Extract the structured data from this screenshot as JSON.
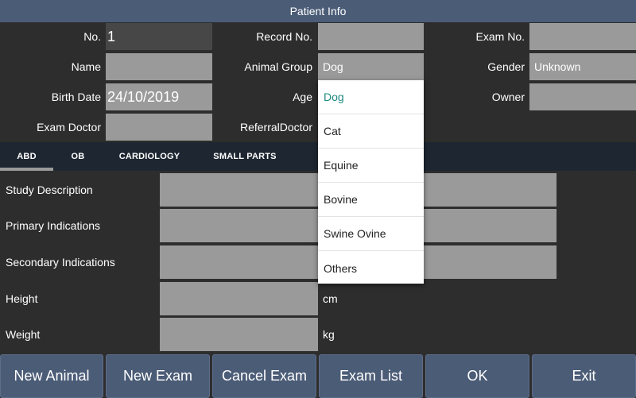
{
  "title": "Patient Info",
  "patient": {
    "no_label": "No.",
    "no_value": "1",
    "record_label": "Record No.",
    "record_value": "",
    "exam_no_label": "Exam No.",
    "exam_no_value": "",
    "name_label": "Name",
    "name_value": "",
    "animal_group_label": "Animal Group",
    "animal_group_value": "Dog",
    "gender_label": "Gender",
    "gender_value": "Unknown",
    "birth_label": "Birth Date",
    "birth_value": "24/10/2019",
    "age_label": "Age",
    "age_value": "",
    "owner_label": "Owner",
    "owner_value": "",
    "doctor_label": "Exam Doctor",
    "doctor_value": "",
    "referral_label": "ReferralDoctor",
    "referral_value": ""
  },
  "tabs": [
    {
      "label": "ABD",
      "active": true
    },
    {
      "label": "OB"
    },
    {
      "label": "CARDIOLOGY"
    },
    {
      "label": "SMALL PARTS"
    }
  ],
  "study": {
    "description_label": "Study Description",
    "primary_label": "Primary Indications",
    "secondary_label": "Secondary Indications",
    "height_label": "Height",
    "height_unit": "cm",
    "weight_label": "Weight",
    "weight_unit": "kg"
  },
  "dropdown": {
    "selected": "Dog",
    "options": [
      "Dog",
      "Cat",
      "Equine",
      "Bovine",
      "Swine Ovine",
      "Others"
    ]
  },
  "buttons": {
    "new_animal": "New Animal",
    "new_exam": "New Exam",
    "cancel_exam": "Cancel Exam",
    "exam_list": "Exam List",
    "ok": "OK",
    "exit": "Exit"
  },
  "colors": {
    "title_bar": "#4b5c77",
    "background": "#2d2d2d",
    "field": "#9a9a9a",
    "tab_bar": "#1e2631",
    "selected_option": "#1f8a80"
  }
}
